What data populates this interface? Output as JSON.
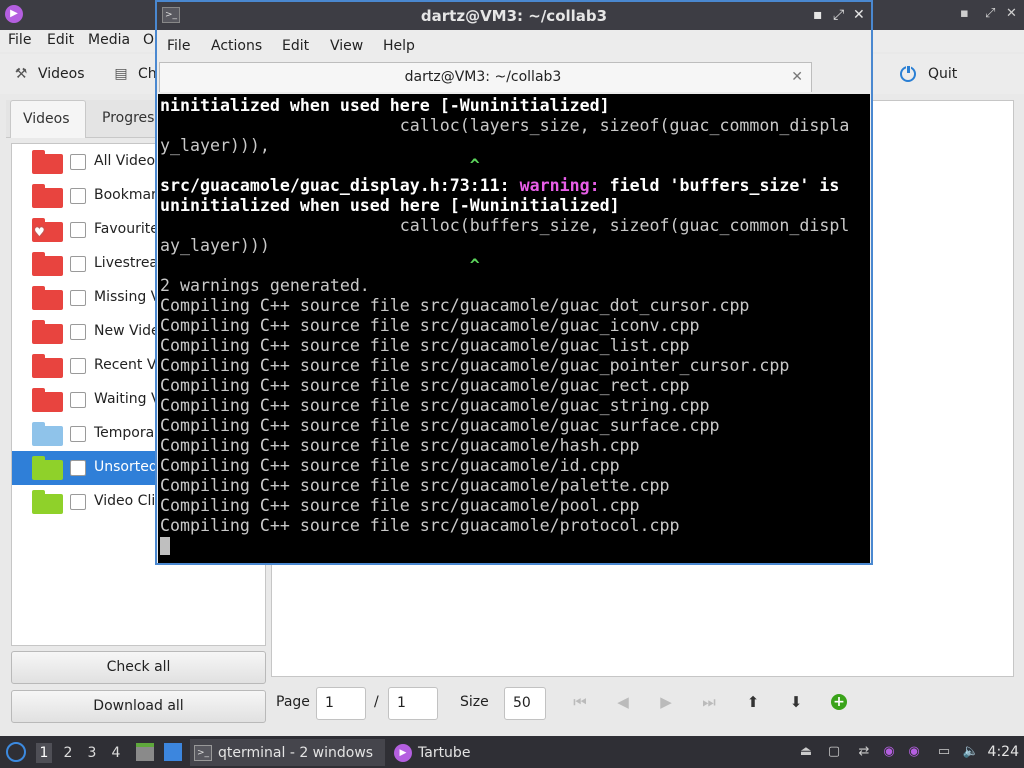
{
  "tartube": {
    "menu": [
      "File",
      "Edit",
      "Media",
      "O"
    ],
    "toolbar": {
      "videos_label": "Videos",
      "second_label": "Ch",
      "quit_label": "Quit"
    },
    "tabs": [
      "Videos",
      "Progress"
    ],
    "folders": [
      {
        "label": "All Videos",
        "color": "#e8443f"
      },
      {
        "label": "Bookmar",
        "color": "#e8443f"
      },
      {
        "label": "Favourite",
        "color": "#e8443f"
      },
      {
        "label": "Livestrea",
        "color": "#e8443f"
      },
      {
        "label": "Missing V",
        "color": "#e8443f"
      },
      {
        "label": "New Vide",
        "color": "#e8443f"
      },
      {
        "label": "Recent Vi",
        "color": "#e8443f"
      },
      {
        "label": "Waiting V",
        "color": "#e8443f"
      },
      {
        "label": "Temporar",
        "color": "#8fc3ea"
      },
      {
        "label": "Unsorted",
        "color": "#8fd12a"
      },
      {
        "label": "Video Cli",
        "color": "#8fd12a"
      }
    ],
    "check_all_label": "Check all",
    "download_all_label": "Download all",
    "bottom": {
      "page_label": "Page",
      "page_value": "1",
      "of_sep": "/",
      "page_total": "1",
      "size_label": "Size",
      "size_value": "50"
    }
  },
  "terminal": {
    "window_title": "dartz@VM3: ~/collab3",
    "menu": [
      "File",
      "Actions",
      "Edit",
      "View",
      "Help"
    ],
    "tab_title": "dartz@VM3: ~/collab3",
    "lines": [
      {
        "text": "ninitialized when used here [-Wuninitialized]",
        "style": "bold"
      },
      {
        "text": "                        calloc(layers_size, sizeof(guac_common_displa",
        "style": "plain"
      },
      {
        "text": "y_layer))),",
        "style": "plain"
      },
      {
        "text": "                               ^",
        "style": "caret"
      },
      {
        "text": "src/guacamole/guac_display.h:73:11: ",
        "warn": "warning:",
        "rest": " field 'buffers_size' is",
        "style": "warnline"
      },
      {
        "text": "uninitialized when used here [-Wuninitialized]",
        "style": "bold"
      },
      {
        "text": "                        calloc(buffers_size, sizeof(guac_common_displ",
        "style": "plain"
      },
      {
        "text": "ay_layer)))",
        "style": "plain"
      },
      {
        "text": "                               ^",
        "style": "caret"
      },
      {
        "text": "2 warnings generated.",
        "style": "plain"
      },
      {
        "text": "Compiling C++ source file src/guacamole/guac_dot_cursor.cpp",
        "style": "plain"
      },
      {
        "text": "Compiling C++ source file src/guacamole/guac_iconv.cpp",
        "style": "plain"
      },
      {
        "text": "Compiling C++ source file src/guacamole/guac_list.cpp",
        "style": "plain"
      },
      {
        "text": "Compiling C++ source file src/guacamole/guac_pointer_cursor.cpp",
        "style": "plain"
      },
      {
        "text": "Compiling C++ source file src/guacamole/guac_rect.cpp",
        "style": "plain"
      },
      {
        "text": "Compiling C++ source file src/guacamole/guac_string.cpp",
        "style": "plain"
      },
      {
        "text": "Compiling C++ source file src/guacamole/guac_surface.cpp",
        "style": "plain"
      },
      {
        "text": "Compiling C++ source file src/guacamole/hash.cpp",
        "style": "plain"
      },
      {
        "text": "Compiling C++ source file src/guacamole/id.cpp",
        "style": "plain"
      },
      {
        "text": "Compiling C++ source file src/guacamole/palette.cpp",
        "style": "plain"
      },
      {
        "text": "Compiling C++ source file src/guacamole/pool.cpp",
        "style": "plain"
      },
      {
        "text": "Compiling C++ source file src/guacamole/protocol.cpp",
        "style": "plain"
      }
    ]
  },
  "taskbar": {
    "desktops": [
      "1",
      "2",
      "3",
      "4"
    ],
    "tasks": [
      {
        "label": "qterminal - 2 windows",
        "icon": "terminal-icon"
      },
      {
        "label": "Tartube",
        "icon": "tartube-icon"
      }
    ],
    "clock": "4:24"
  }
}
